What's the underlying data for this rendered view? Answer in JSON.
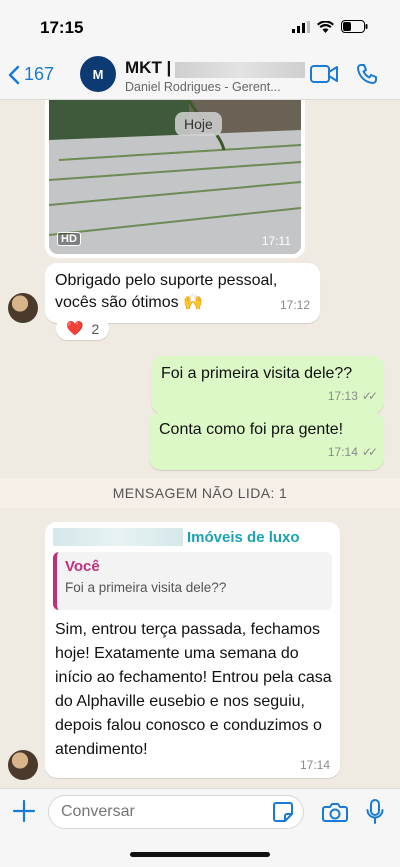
{
  "status": {
    "time": "17:15"
  },
  "header": {
    "back_count": "167",
    "avatar_text": "M",
    "chat_name": "MKT |",
    "subtitle": "Daniel Rodrigues - Gerent..."
  },
  "messages": {
    "image_date_pill": "Hoje",
    "image_hd": "HD",
    "image_time": "17:11",
    "msg1_text": "Obrigado pelo suporte pessoal, vocês são ótimos 🙌",
    "msg1_time": "17:12",
    "reaction_emoji": "❤️",
    "reaction_count": "2",
    "out1_text": "Foi a primeira visita dele??",
    "out1_time": "17:13",
    "out2_text": "Conta como foi pra gente!",
    "out2_time": "17:14"
  },
  "unread": {
    "label": "MENSAGEM NÃO LIDA: 1"
  },
  "reply": {
    "group_name": "Imóveis de luxo",
    "quote_author": "Você",
    "quote_text": "Foi a primeira visita dele??",
    "body": "Sim, entrou terça passada, fechamos hoje! Exatamente uma semana do início ao fechamento! Entrou pela casa do Alphaville eusebio e nos seguiu, depois falou conosco e conduzimos o atendimento!",
    "time": "17:14"
  },
  "input": {
    "placeholder": "Conversar"
  },
  "colors": {
    "accent": "#1a7bd6",
    "outgoing_bubble": "#dcf8c6",
    "quote_author": "#c0307a",
    "group_name": "#1aa3b0"
  },
  "icons": [
    "signal-icon",
    "wifi-icon",
    "battery-icon",
    "back-chevron-icon",
    "video-call-icon",
    "phone-call-icon",
    "plus-icon",
    "sticker-icon",
    "camera-icon",
    "microphone-icon"
  ]
}
